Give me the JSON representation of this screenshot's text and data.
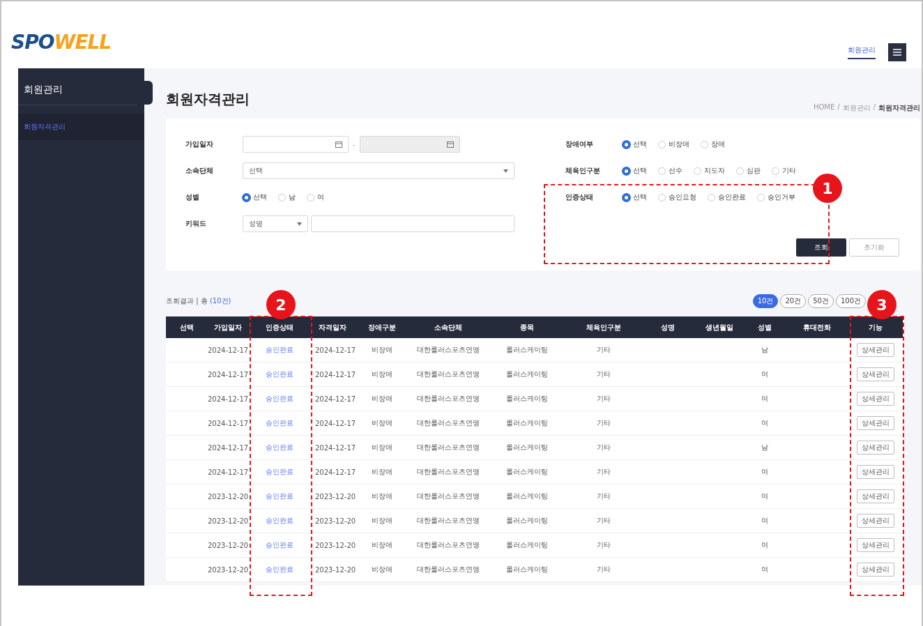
{
  "header": {
    "logo": [
      "SPO",
      "WELL"
    ],
    "nav_link": {
      "label": "회원관리",
      "selected": true
    }
  },
  "sidebar": {
    "section": "회원관리",
    "items": [
      {
        "label": "회원자격관리",
        "selected": true
      }
    ]
  },
  "page": {
    "title": "회원자격관리",
    "breadcrumb": [
      {
        "kind": "link",
        "text": "HOME"
      },
      {
        "kind": "separator",
        "text": "/"
      },
      {
        "kind": "link",
        "text": "회원관리"
      },
      {
        "kind": "separator",
        "text": "/"
      },
      {
        "kind": "current",
        "text": "회원자격관리"
      }
    ]
  },
  "filters": {
    "left": [
      {
        "kind": "date-range",
        "label": "가입일자",
        "separator": "-"
      },
      {
        "kind": "select",
        "label": "소속단체",
        "value": "선택"
      },
      {
        "kind": "radio",
        "label": "성별",
        "options": [
          {
            "label": "선택",
            "selected": true
          },
          {
            "label": "남",
            "selected": false
          },
          {
            "label": "여",
            "selected": false
          }
        ]
      },
      {
        "kind": "keyword",
        "label": "키워드",
        "value": "성명"
      }
    ],
    "right": [
      {
        "kind": "radio",
        "label": "장애여부",
        "options": [
          {
            "label": "선택",
            "selected": true
          },
          {
            "label": "비장애",
            "selected": false
          },
          {
            "label": "장애",
            "selected": false
          }
        ]
      },
      {
        "kind": "radio",
        "label": "체육인구분",
        "options": [
          {
            "label": "선택",
            "selected": true
          },
          {
            "label": "선수",
            "selected": false
          },
          {
            "label": "지도자",
            "selected": false
          },
          {
            "label": "심판",
            "selected": false
          },
          {
            "label": "기타",
            "selected": false
          }
        ]
      },
      {
        "kind": "radio",
        "label": "인증상태",
        "options": [
          {
            "label": "선택",
            "selected": true
          },
          {
            "label": "승인요청",
            "selected": false
          },
          {
            "label": "승인완료",
            "selected": false
          },
          {
            "label": "승인거부",
            "selected": false
          }
        ]
      }
    ],
    "buttons": [
      {
        "label": "조회",
        "kind": "primary"
      },
      {
        "label": "초기화",
        "kind": "secondary"
      }
    ]
  },
  "results": {
    "summary": "조회결과 | 총",
    "count": "(10건)",
    "page_sizes": [
      {
        "label": "10건",
        "selected": true
      },
      {
        "label": "20건",
        "selected": false
      },
      {
        "label": "50건",
        "selected": false
      },
      {
        "label": "100건",
        "selected": false
      }
    ]
  },
  "table": {
    "columns": [
      "선택",
      "가입일자",
      "인증상태",
      "자격일자",
      "장애구분",
      "소속단체",
      "종목",
      "체육인구분",
      "성명",
      "생년월일",
      "성별",
      "휴대전화",
      "기능"
    ],
    "rows": [
      {
        "join_date": "2024-12-17",
        "status": "승인완료",
        "qual_date": "2024-12-17",
        "disability": "비장애",
        "org": "대한롤러스포츠연맹",
        "sport": "롤러스케이팅",
        "category": "기타",
        "gender": "남",
        "action": "상세관리"
      },
      {
        "join_date": "2024-12-17",
        "status": "승인완료",
        "qual_date": "2024-12-17",
        "disability": "비장애",
        "org": "대한롤러스포츠연맹",
        "sport": "롤러스케이팅",
        "category": "기타",
        "gender": "여",
        "action": "상세관리"
      },
      {
        "join_date": "2024-12-17",
        "status": "승인완료",
        "qual_date": "2024-12-17",
        "disability": "비장애",
        "org": "대한롤러스포츠연맹",
        "sport": "롤러스케이팅",
        "category": "기타",
        "gender": "여",
        "action": "상세관리"
      },
      {
        "join_date": "2024-12-17",
        "status": "승인완료",
        "qual_date": "2024-12-17",
        "disability": "비장애",
        "org": "대한롤러스포츠연맹",
        "sport": "롤러스케이팅",
        "category": "기타",
        "gender": "여",
        "action": "상세관리"
      },
      {
        "join_date": "2024-12-17",
        "status": "승인완료",
        "qual_date": "2024-12-17",
        "disability": "비장애",
        "org": "대한롤러스포츠연맹",
        "sport": "롤러스케이팅",
        "category": "기타",
        "gender": "남",
        "action": "상세관리"
      },
      {
        "join_date": "2024-12-17",
        "status": "승인완료",
        "qual_date": "2024-12-17",
        "disability": "비장애",
        "org": "대한롤러스포츠연맹",
        "sport": "롤러스케이팅",
        "category": "기타",
        "gender": "여",
        "action": "상세관리"
      },
      {
        "join_date": "2023-12-20",
        "status": "승인완료",
        "qual_date": "2023-12-20",
        "disability": "비장애",
        "org": "대한롤러스포츠연맹",
        "sport": "롤러스케이팅",
        "category": "기타",
        "gender": "여",
        "action": "상세관리"
      },
      {
        "join_date": "2023-12-20",
        "status": "승인완료",
        "qual_date": "2023-12-20",
        "disability": "비장애",
        "org": "대한롤러스포츠연맹",
        "sport": "롤러스케이팅",
        "category": "기타",
        "gender": "여",
        "action": "상세관리"
      },
      {
        "join_date": "2023-12-20",
        "status": "승인완료",
        "qual_date": "2023-12-20",
        "disability": "비장애",
        "org": "대한롤러스포츠연맹",
        "sport": "롤러스케이팅",
        "category": "기타",
        "gender": "여",
        "action": "상세관리"
      },
      {
        "join_date": "2023-12-20",
        "status": "승인완료",
        "qual_date": "2023-12-20",
        "disability": "비장애",
        "org": "대한롤러스포츠연맹",
        "sport": "롤러스케이팅",
        "category": "기타",
        "gender": "여",
        "action": "상세관리"
      }
    ]
  },
  "annotations": [
    "1",
    "2",
    "3"
  ]
}
